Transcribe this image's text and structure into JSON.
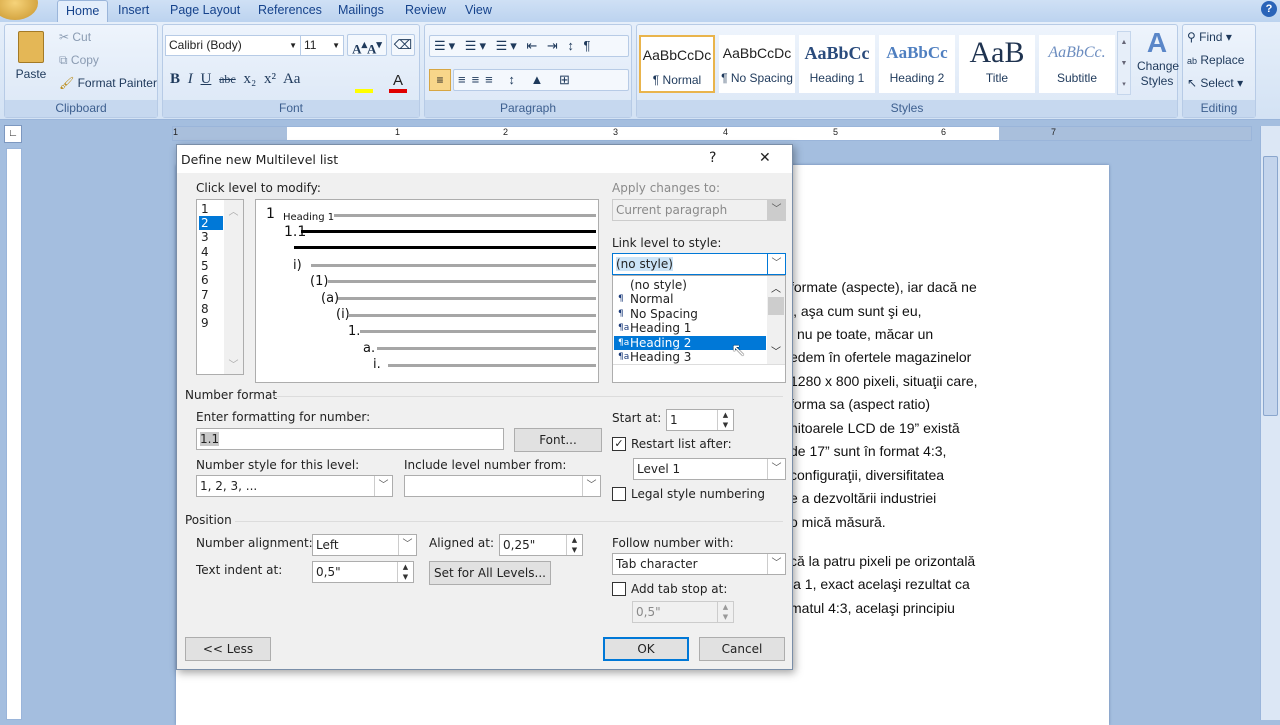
{
  "ribbon": {
    "tabs": [
      "Home",
      "Insert",
      "Page Layout",
      "References",
      "Mailings",
      "Review",
      "View"
    ],
    "clipboard": {
      "paste": "Paste",
      "cut": "Cut",
      "copy": "Copy",
      "format_painter": "Format Painter",
      "label": "Clipboard"
    },
    "font": {
      "name": "Calibri (Body)",
      "size": "11",
      "label": "Font",
      "highlight_color": "#ffff00",
      "font_color": "#e00000"
    },
    "paragraph": {
      "label": "Paragraph"
    },
    "styles": {
      "items": [
        {
          "preview": "AaBbCcDc",
          "name": "¶ Normal"
        },
        {
          "preview": "AaBbCcDc",
          "name": "¶ No Spacing"
        },
        {
          "preview": "AaBbCc",
          "name": "Heading 1"
        },
        {
          "preview": "AaBbCc",
          "name": "Heading 2"
        },
        {
          "preview": "AaB",
          "name": "Title"
        },
        {
          "preview": "AaBbCc.",
          "name": "Subtitle"
        }
      ],
      "change_styles": "Change Styles",
      "label": "Styles"
    },
    "editing": {
      "find": "Find",
      "replace": "Replace",
      "select": "Select",
      "label": "Editing"
    }
  },
  "ruler": {
    "marks": [
      "1",
      "1",
      "2",
      "3",
      "4",
      "5",
      "6",
      "7"
    ]
  },
  "document": {
    "lines": [
      "formate (aspecte), iar dacă ne",
      "l, aşa cum sunt şi eu,",
      "i nu pe toate, măcar un",
      "edem în ofertele magazinelor",
      "1280 x 800 pixeli, situaţii care,",
      "forma sa (aspect ratio)",
      "nitoarele LCD de 19” există",
      "de 17” sunt în format 4:3,",
      "configuraţii, diversifitatea",
      "e a dezvoltării industriei",
      "o mică măsură.",
      "că la patru pixeli pe orizontală",
      "la 1, exact acelaşi rezultat ca",
      "matul 4:3, acelaşi principiu"
    ]
  },
  "dialog": {
    "title": "Define new Multilevel list",
    "help": "?",
    "close": "✕",
    "click_level_label": "Click level to modify:",
    "levels": [
      "1",
      "2",
      "3",
      "4",
      "5",
      "6",
      "7",
      "8",
      "9"
    ],
    "selected_level": "2",
    "preview": {
      "level1_number": "1",
      "level1_style": "Heading 1",
      "numbers": [
        "1.1",
        "i)",
        "(1)",
        "(a)",
        "(i)",
        "1.",
        "a.",
        "i."
      ]
    },
    "apply_changes_label": "Apply changes to:",
    "apply_changes_value": "Current paragraph",
    "link_level_label": "Link level to style:",
    "link_level_value": "(no style)",
    "style_options": [
      {
        "icon": "",
        "name": "(no style)"
      },
      {
        "icon": "¶",
        "name": "Normal"
      },
      {
        "icon": "¶",
        "name": "No Spacing"
      },
      {
        "icon": "¶a",
        "name": "Heading 1"
      },
      {
        "icon": "¶a",
        "name": "Heading 2"
      },
      {
        "icon": "¶a",
        "name": "Heading 3"
      }
    ],
    "style_selected": "Heading 2",
    "number_format_label": "Number format",
    "enter_formatting_label": "Enter formatting for number:",
    "formatting_value": "1.1",
    "font_button": "Font...",
    "number_style_label": "Number style for this level:",
    "number_style_value": "1, 2, 3, ...",
    "include_level_label": "Include level number from:",
    "include_level_value": "",
    "start_at_label": "Start at:",
    "start_at_value": "1",
    "restart_label": "Restart list after:",
    "restart_checked": true,
    "restart_value": "Level 1",
    "legal_label": "Legal style numbering",
    "legal_checked": false,
    "position_label": "Position",
    "alignment_label": "Number alignment:",
    "alignment_value": "Left",
    "aligned_at_label": "Aligned at:",
    "aligned_at_value": "0,25\"",
    "indent_label": "Text indent at:",
    "indent_value": "0,5\"",
    "set_all_button": "Set for All Levels...",
    "follow_label": "Follow number with:",
    "follow_value": "Tab character",
    "tab_stop_label": "Add tab stop at:",
    "tab_stop_checked": false,
    "tab_stop_value": "0,5\"",
    "less_button": "<< Less",
    "ok_button": "OK",
    "cancel_button": "Cancel"
  }
}
